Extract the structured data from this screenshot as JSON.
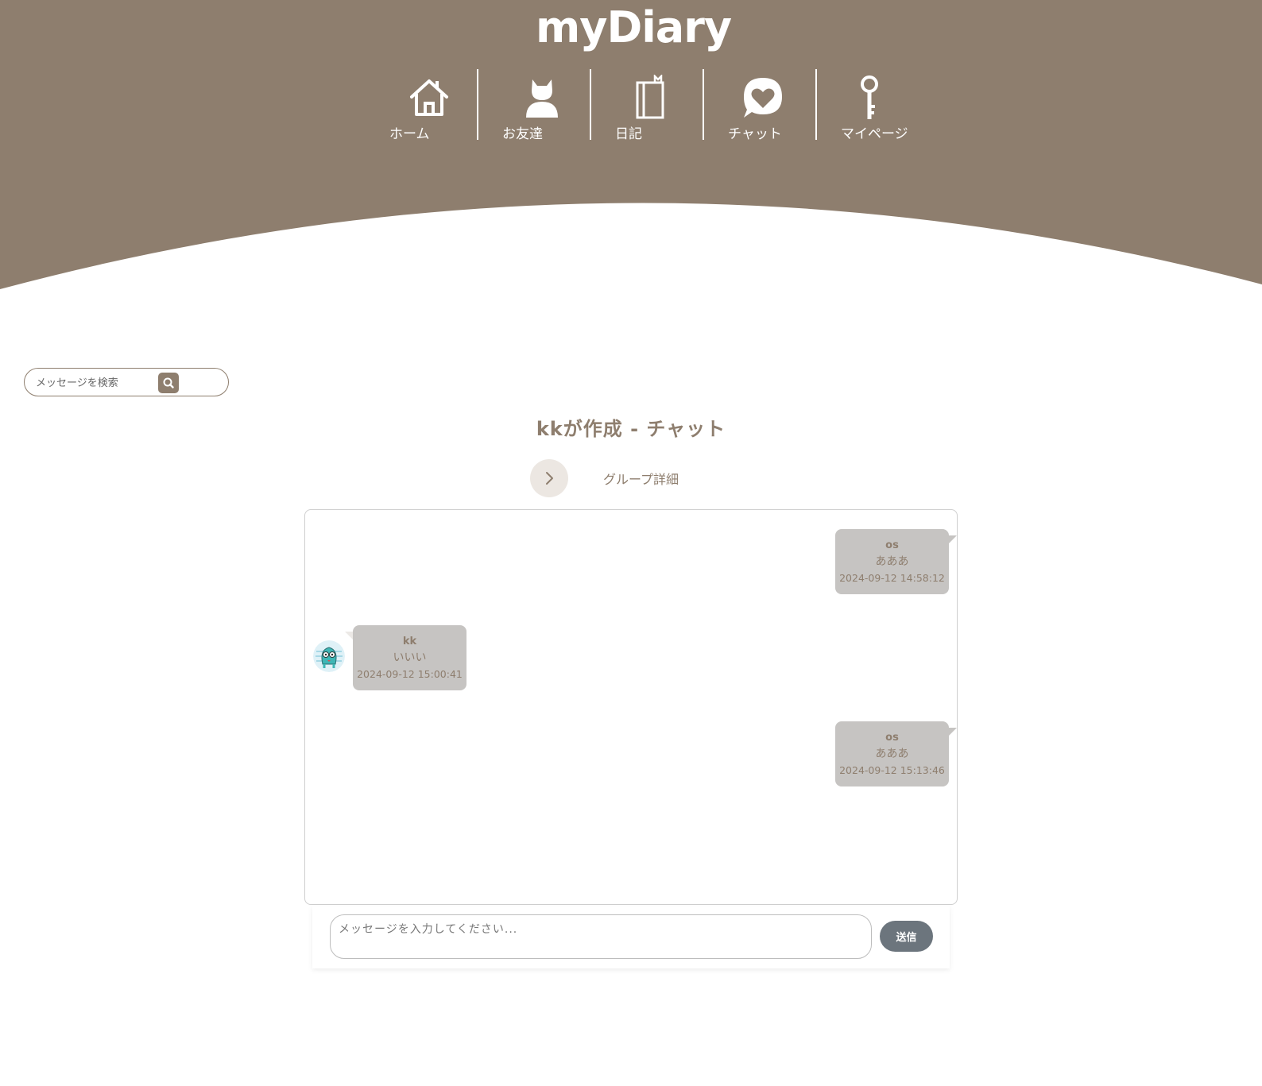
{
  "brand": {
    "logo": "myDiary",
    "header_color": "#8e7e6e"
  },
  "nav": {
    "items": [
      {
        "label": "ホーム",
        "icon": "home-icon"
      },
      {
        "label": "お友達",
        "icon": "friend-icon"
      },
      {
        "label": "日記",
        "icon": "diary-icon"
      },
      {
        "label": "チャット",
        "icon": "chat-heart-icon"
      },
      {
        "label": "マイページ",
        "icon": "key-icon"
      }
    ]
  },
  "search": {
    "placeholder": "メッセージを検索",
    "icon": "search-icon"
  },
  "chat": {
    "title": "kkが作成 - チャット",
    "group_detail_label": "グループ詳細",
    "messages": [
      {
        "name": "os",
        "text": "あああ",
        "time": "2024-09-12 14:58:12",
        "side": "right"
      },
      {
        "name": "kk",
        "text": "いいい",
        "time": "2024-09-12 15:00:41",
        "side": "left"
      },
      {
        "name": "os",
        "text": "あああ",
        "time": "2024-09-12 15:13:46",
        "side": "right"
      }
    ]
  },
  "composer": {
    "placeholder": "メッセージを入力してください...",
    "send_label": "送信",
    "send_color": "#6c757d"
  }
}
